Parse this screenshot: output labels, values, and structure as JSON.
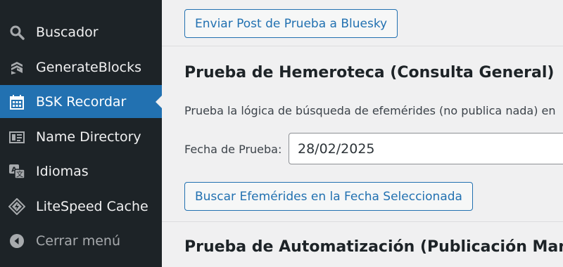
{
  "sidebar": {
    "items": [
      {
        "label": "Buscador",
        "icon": "search-icon"
      },
      {
        "label": "GenerateBlocks",
        "icon": "generateblocks-icon"
      },
      {
        "label": "BSK Recordar",
        "icon": "calendar-icon",
        "active": true
      },
      {
        "label": "Name Directory",
        "icon": "directory-icon"
      },
      {
        "label": "Idiomas",
        "icon": "translate-icon"
      },
      {
        "label": "LiteSpeed Cache",
        "icon": "litespeed-icon"
      }
    ],
    "collapse_label": "Cerrar menú"
  },
  "main": {
    "send_test_button": "Enviar Post de Prueba a Bluesky",
    "archive_section": {
      "title": "Prueba de Hemeroteca (Consulta General)",
      "description": "Prueba la lógica de búsqueda de efemérides (no publica nada) en",
      "date_label": "Fecha de Prueba:",
      "date_value": "28/02/2025",
      "search_button": "Buscar Efemérides en la Fecha Seleccionada"
    },
    "automation_section": {
      "title": "Prueba de Automatización (Publicación Manual"
    }
  },
  "colors": {
    "sidebar_bg": "#1d2327",
    "active_bg": "#2271b1",
    "accent": "#2271b1",
    "content_bg": "#f0f0f1"
  }
}
